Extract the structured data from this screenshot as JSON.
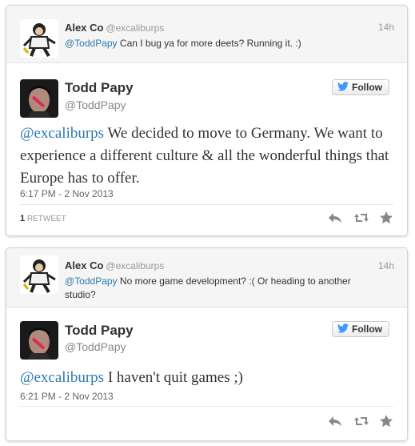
{
  "tweets": [
    {
      "reply": {
        "name": "Alex Co",
        "handle": "@excaliburps",
        "time": "14h",
        "mention": "@ToddPapy",
        "text": " Can I bug ya for more deets? Running it. :)"
      },
      "main": {
        "name": "Todd Papy",
        "handle": "@ToddPapy",
        "follow_label": "Follow",
        "mention": "@excaliburps",
        "text": " We decided to move to Germany. We want to experience a different culture & all the wonderful things that Europe has to offer.",
        "date": "6:17 PM - 2 Nov 2013",
        "retweet_number": "1",
        "retweet_label": " RETWEET"
      }
    },
    {
      "reply": {
        "name": "Alex Co",
        "handle": "@excaliburps",
        "time": "14h",
        "mention": "@ToddPapy",
        "text": " No more game development? :( Or heading to another studio?"
      },
      "main": {
        "name": "Todd Papy",
        "handle": "@ToddPapy",
        "follow_label": "Follow",
        "mention": "@excaliburps",
        "text": " I haven't quit games ;)",
        "date": "6:21 PM - 2 Nov 2013"
      }
    }
  ],
  "icons": {
    "follow": "twitter-bird-icon",
    "actions": [
      "reply-icon",
      "retweet-icon",
      "favorite-icon"
    ]
  },
  "colors": {
    "link": "#2a7ab0",
    "icon": "#888888"
  }
}
